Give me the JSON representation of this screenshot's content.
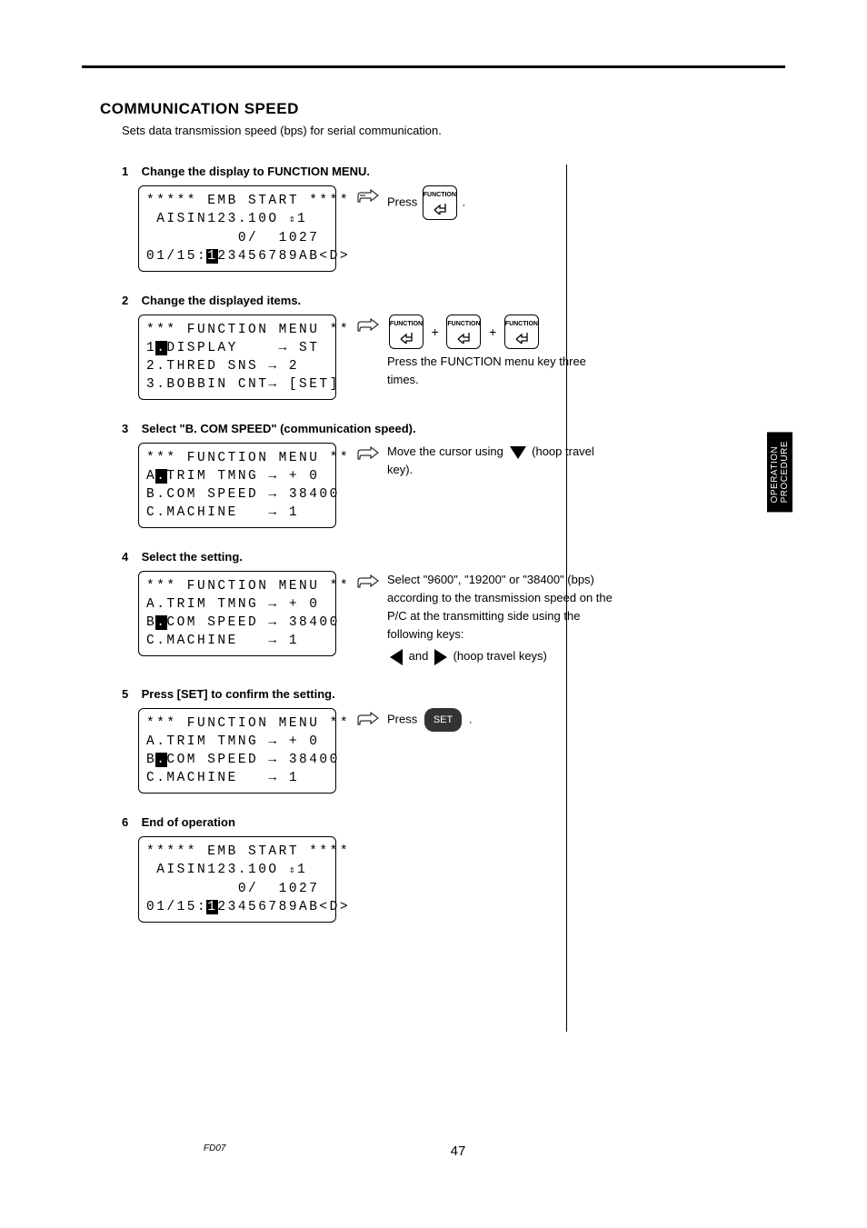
{
  "header": {
    "title": "COMMUNICATION SPEED",
    "intro": "Sets data transmission speed (bps) for serial communication."
  },
  "sideTab": {
    "line1": "OPERATION",
    "line2": "PROCEDURE"
  },
  "steps": {
    "s1": {
      "num": "1",
      "title": "Change the display to FUNCTION MENU.",
      "lcd": {
        "l1": "***** EMB START ****",
        "l2a": " AISIN123.10O ",
        "l2b": "1",
        "l3": "         0/  1027",
        "l4a": "01/15:",
        "l4b": "23456789AB<D>"
      },
      "instr_a": "Press ",
      "instr_b": " .",
      "key": "FUNCTION"
    },
    "s2": {
      "num": "2",
      "title": "Change the displayed items.",
      "lcd": {
        "l1": "*** FUNCTION MENU **",
        "l2a": "1",
        "l2b": "DISPLAY    → ST",
        "l3": "2.THRED SNS → 2",
        "l4": "3.BOBBIN CNT→ [SET]"
      },
      "instr": "Press the FUNCTION menu key three times.",
      "key": "FUNCTION"
    },
    "s3": {
      "num": "3",
      "title": "Select \"B. COM SPEED\" (communication speed).",
      "lcd": {
        "l1": "*** FUNCTION MENU **",
        "l2a": "A",
        "l2b": "TRIM TMNG → + 0",
        "l3": "B.COM SPEED → 38400",
        "l4": "C.MACHINE   → 1"
      },
      "instr_a": "Move the cursor using ",
      "instr_b": " (hoop travel key)."
    },
    "s4": {
      "num": "4",
      "title": "Select the setting.",
      "lcd": {
        "l1": "*** FUNCTION MENU **",
        "l2": "A.TRIM TMNG → + 0",
        "l3a": "B",
        "l3b": "COM SPEED → 38400",
        "l4": "C.MACHINE   → 1"
      },
      "instr1": "Select \"9600\", \"19200\" or \"38400\" (bps) according to the transmission speed on the P/C at the transmitting side using the following keys:",
      "instr2a": " and ",
      "instr2b": " (hoop travel keys)"
    },
    "s5": {
      "num": "5",
      "title": "Press [SET] to confirm the setting.",
      "lcd": {
        "l1": "*** FUNCTION MENU **",
        "l2": "A.TRIM TMNG → + 0",
        "l3a": "B",
        "l3b": "COM SPEED → 38400",
        "l4": "C.MACHINE   → 1"
      },
      "instr_a": "Press ",
      "instr_b": " .",
      "setkey": "SET"
    },
    "s6": {
      "num": "6",
      "title": "End of operation",
      "lcd": {
        "l1": "***** EMB START ****",
        "l2a": " AISIN123.10O ",
        "l2b": "1",
        "l3": "         0/  1027",
        "l4a": "01/15:",
        "l4b": "23456789AB<D>"
      }
    }
  },
  "footer": {
    "pageNum": "47",
    "docId": "FD07"
  }
}
